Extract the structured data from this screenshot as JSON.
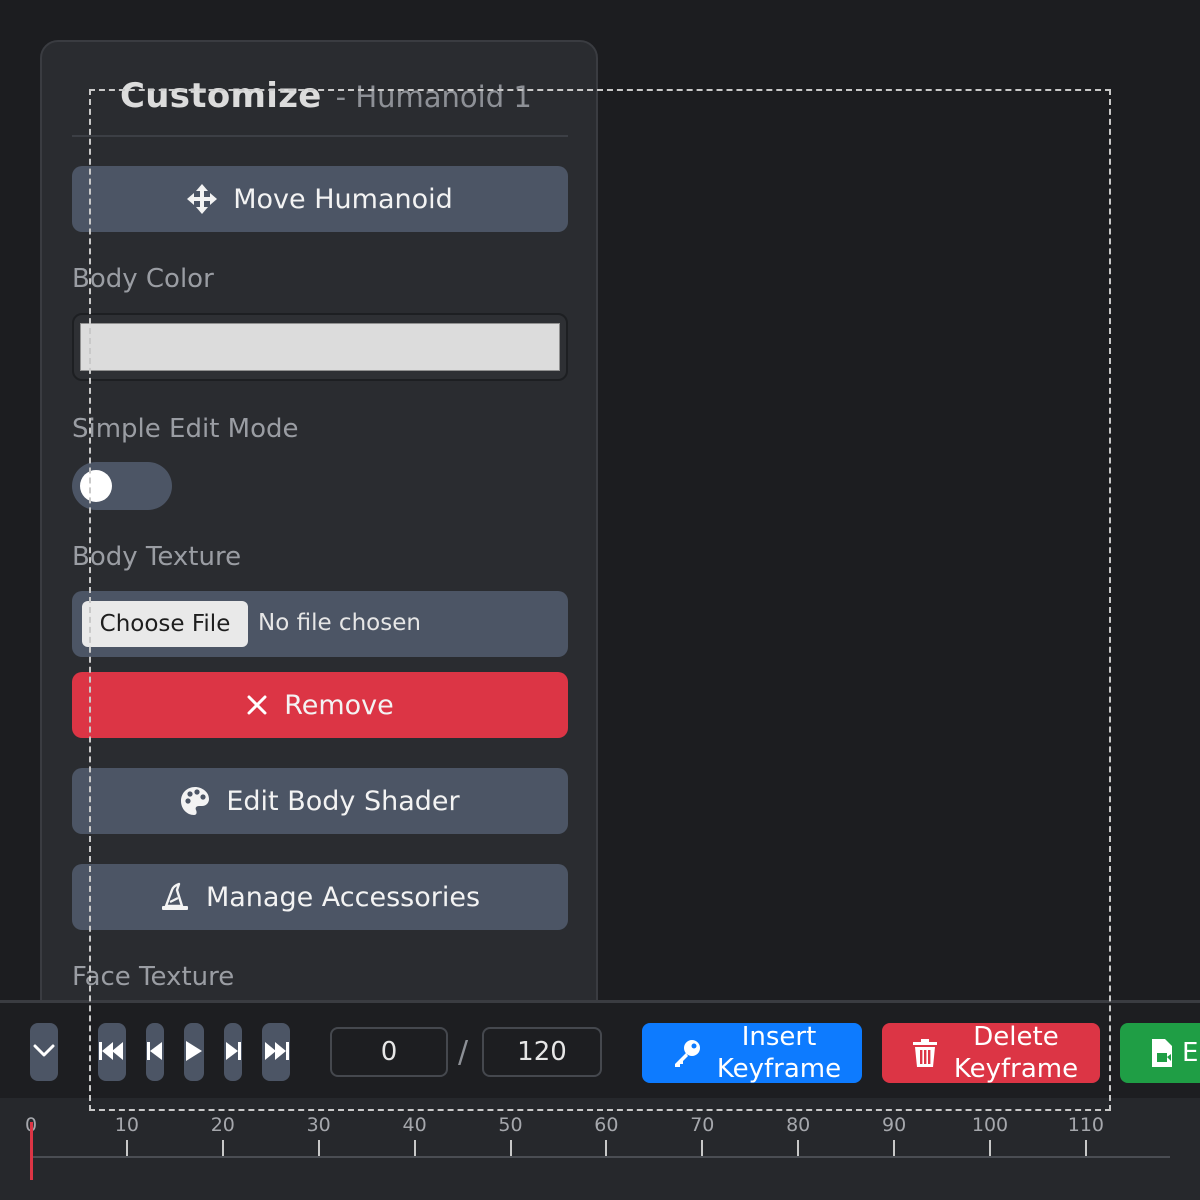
{
  "panel": {
    "title": "Customize",
    "subtitle": "- Humanoid 1",
    "move_button": "Move Humanoid",
    "body_color_label": "Body Color",
    "body_color_value": "#dcdcdc",
    "simple_edit_label": "Simple Edit Mode",
    "simple_edit_on": false,
    "body_texture_label": "Body Texture",
    "file_button": "Choose File",
    "file_status": "No file chosen",
    "remove_button": "Remove",
    "shader_button": "Edit Body Shader",
    "accessories_button": "Manage Accessories",
    "face_texture_label": "Face Texture"
  },
  "toolbar": {
    "current_frame": "0",
    "separator": "/",
    "total_frames": "120",
    "insert_line1": "Insert",
    "insert_line2": "Keyframe",
    "delete_line1": "Delete",
    "delete_line2": "Keyframe",
    "export_partial": "E"
  },
  "timeline": {
    "ticks": [
      "0",
      "10",
      "20",
      "30",
      "40",
      "50",
      "60",
      "70",
      "80",
      "90",
      "100",
      "110"
    ],
    "playhead_frame": 0
  },
  "colors": {
    "accent_blue": "#0d7bff",
    "danger_red": "#dc3545",
    "success_green": "#1f9e45",
    "button_gray": "#4c5565"
  }
}
